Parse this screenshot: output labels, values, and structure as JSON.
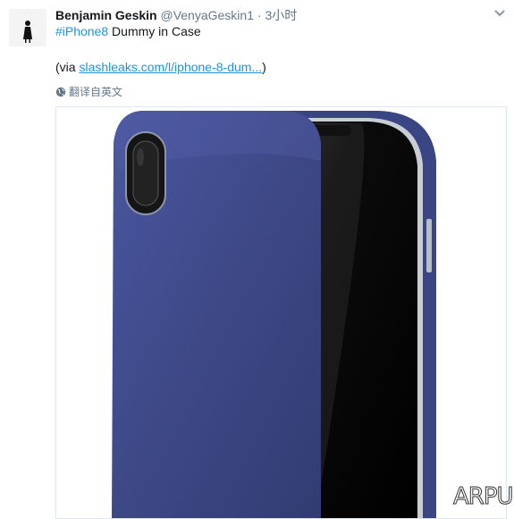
{
  "tweet": {
    "author_name": "Benjamin Geskin",
    "handle": "@VenyaGeskin1",
    "separator": "·",
    "time": "3小时",
    "hashtag": "#iPhone8",
    "text_rest": " Dummy in Case",
    "via_prefix": "(via ",
    "via_link": "slashleaks.com/l/iphone-8-dum...",
    "via_suffix": ")",
    "translate_label": "翻译自英文"
  },
  "watermark": "ARPUN",
  "icons": {
    "avatar": "avatar",
    "menu": "chevron-down-icon",
    "translate": "globe-icon"
  },
  "colors": {
    "hashtag": "#1b95e0",
    "link": "#1b95e0",
    "secondary": "#657786",
    "case": "#3e4a88"
  }
}
